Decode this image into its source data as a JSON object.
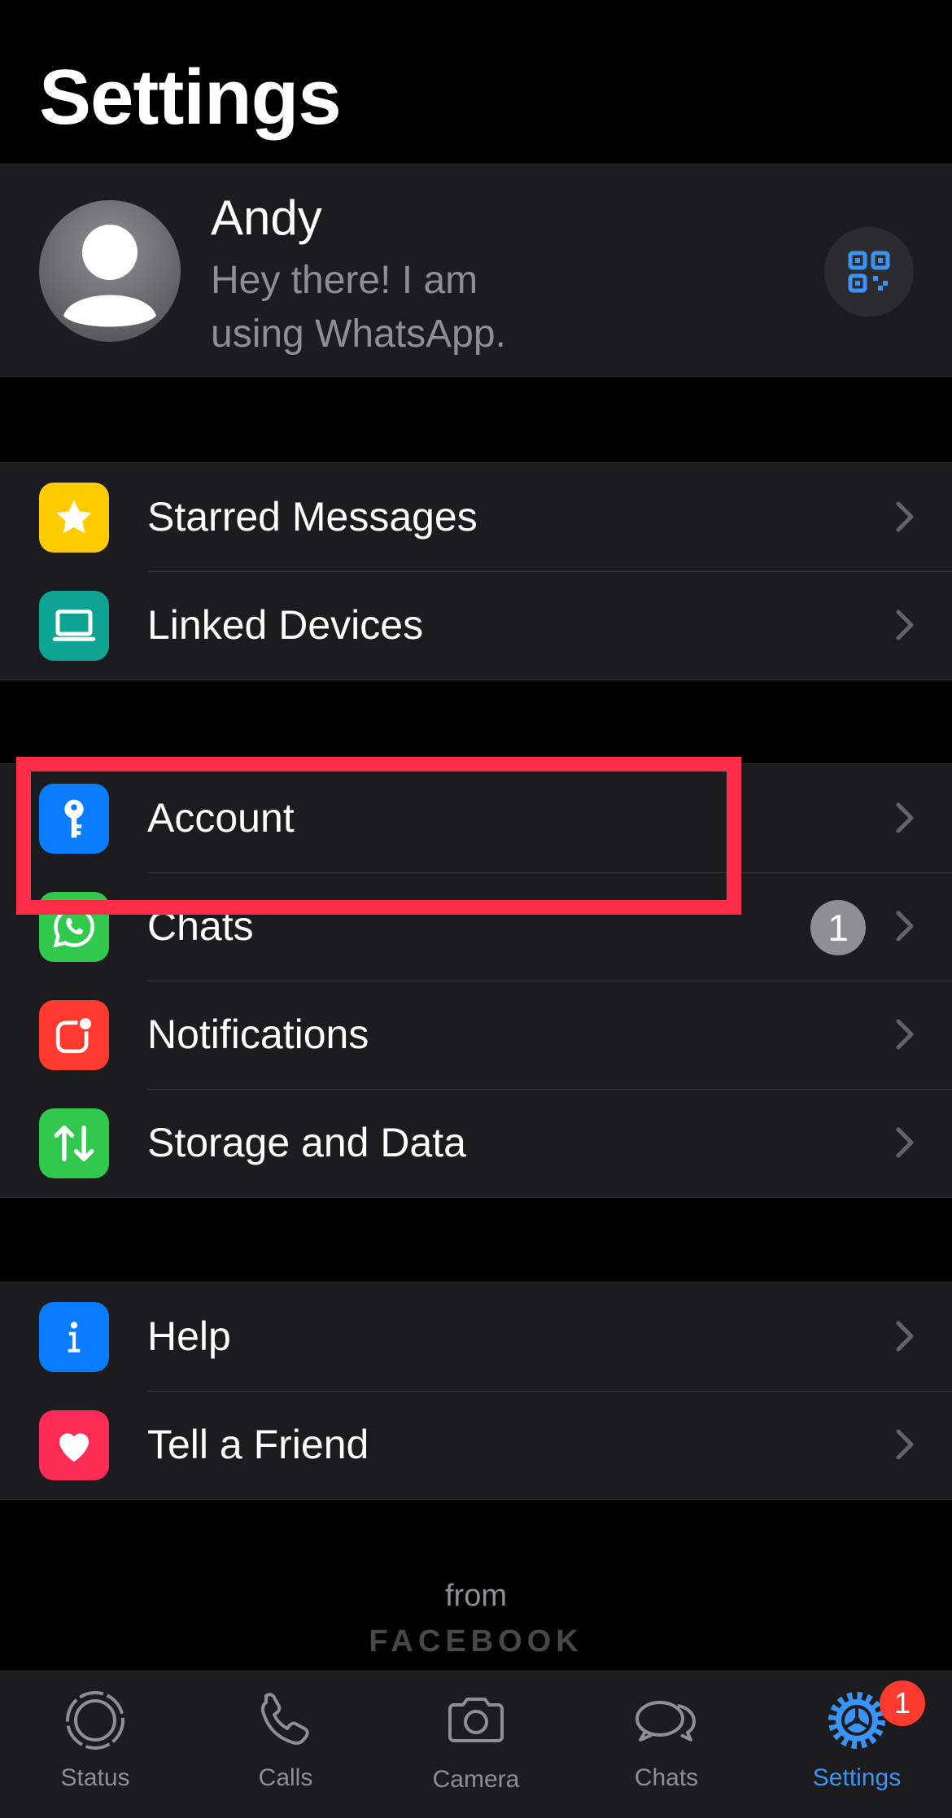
{
  "page": {
    "title": "Settings"
  },
  "profile": {
    "name": "Andy",
    "status": "Hey there! I am using WhatsApp."
  },
  "groups": [
    {
      "items": [
        {
          "label": "Starred Messages",
          "icon": "star-icon",
          "color": "#ffcc00"
        },
        {
          "label": "Linked Devices",
          "icon": "laptop-icon",
          "color": "#0fa394"
        }
      ]
    },
    {
      "items": [
        {
          "label": "Account",
          "icon": "key-icon",
          "color": "#0a7cff"
        },
        {
          "label": "Chats",
          "icon": "whatsapp-icon",
          "color": "#30c84d",
          "badge": "1"
        },
        {
          "label": "Notifications",
          "icon": "notification-icon",
          "color": "#ff3b30"
        },
        {
          "label": "Storage and Data",
          "icon": "up-down-arrows-icon",
          "color": "#30c84d"
        }
      ]
    },
    {
      "items": [
        {
          "label": "Help",
          "icon": "info-icon",
          "color": "#0a7cff"
        },
        {
          "label": "Tell a Friend",
          "icon": "heart-icon",
          "color": "#ff2d55"
        }
      ]
    }
  ],
  "footer": {
    "from": "from",
    "brand": "FACEBOOK"
  },
  "tabbar": {
    "tabs": [
      {
        "label": "Status",
        "icon": "status-icon"
      },
      {
        "label": "Calls",
        "icon": "phone-icon"
      },
      {
        "label": "Camera",
        "icon": "camera-icon"
      },
      {
        "label": "Chats",
        "icon": "chat-bubbles-icon"
      },
      {
        "label": "Settings",
        "icon": "settings-gear-icon",
        "active": true,
        "badge": "1"
      }
    ]
  },
  "colors": {
    "accent": "#3b93f6",
    "highlight": "#ff2d48",
    "background": "#000000",
    "card": "#1c1c1e"
  }
}
